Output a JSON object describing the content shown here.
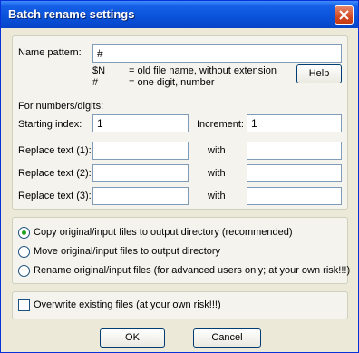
{
  "window": {
    "title": "Batch rename settings"
  },
  "pattern": {
    "label": "Name pattern:",
    "value": "#",
    "help_lines": [
      {
        "token": "$N",
        "desc": "= old file name, without extension"
      },
      {
        "token": "#",
        "desc": "= one digit, number"
      }
    ],
    "help_button": "Help"
  },
  "numbers": {
    "heading": "For numbers/digits:",
    "start_label": "Starting index:",
    "start_value": "1",
    "increment_label": "Increment:",
    "increment_value": "1"
  },
  "replace": [
    {
      "label": "Replace text (1):",
      "with_label": "with",
      "from": "",
      "to": ""
    },
    {
      "label": "Replace text (2):",
      "with_label": "with",
      "from": "",
      "to": ""
    },
    {
      "label": "Replace text (3):",
      "with_label": "with",
      "from": "",
      "to": ""
    }
  ],
  "mode": {
    "options": [
      {
        "label": "Copy original/input files to output directory (recommended)",
        "selected": true
      },
      {
        "label": "Move original/input files to output directory",
        "selected": false
      },
      {
        "label": "Rename original/input files (for advanced users only; at your own risk!!!)",
        "selected": false
      }
    ]
  },
  "overwrite": {
    "label": "Overwrite existing files (at your own risk!!!)",
    "checked": false
  },
  "buttons": {
    "ok": "OK",
    "cancel": "Cancel"
  }
}
